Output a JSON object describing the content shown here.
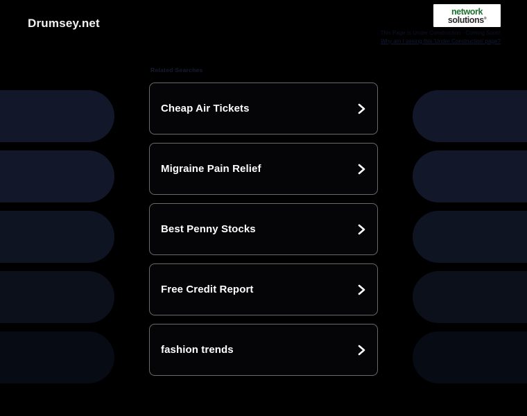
{
  "page": {
    "domain_title": "Drumsey.net",
    "background_color": "#000000",
    "accent_card_border": "#6a6a6a",
    "decor_color": "#141a2c"
  },
  "header": {
    "logo": {
      "icon_name": "network-solutions-logo",
      "word1": "network",
      "word2": "solutions",
      "trademark": "®",
      "word1_color": "#1d7030",
      "word2_color": "#2b2b2b"
    },
    "construction_text": "This Page Is Under Construction - Coming Soon!",
    "construction_link": "Why am I seeing this 'Under Construction' page?"
  },
  "results": {
    "section_label": "Related Searches",
    "items": [
      {
        "label": "Cheap Air Tickets",
        "chevron_icon": "chevron-right-icon"
      },
      {
        "label": "Migraine Pain Relief",
        "chevron_icon": "chevron-right-icon"
      },
      {
        "label": "Best Penny Stocks",
        "chevron_icon": "chevron-right-icon"
      },
      {
        "label": "Free Credit Report",
        "chevron_icon": "chevron-right-icon"
      },
      {
        "label": "fashion trends",
        "chevron_icon": "chevron-right-icon"
      }
    ]
  }
}
